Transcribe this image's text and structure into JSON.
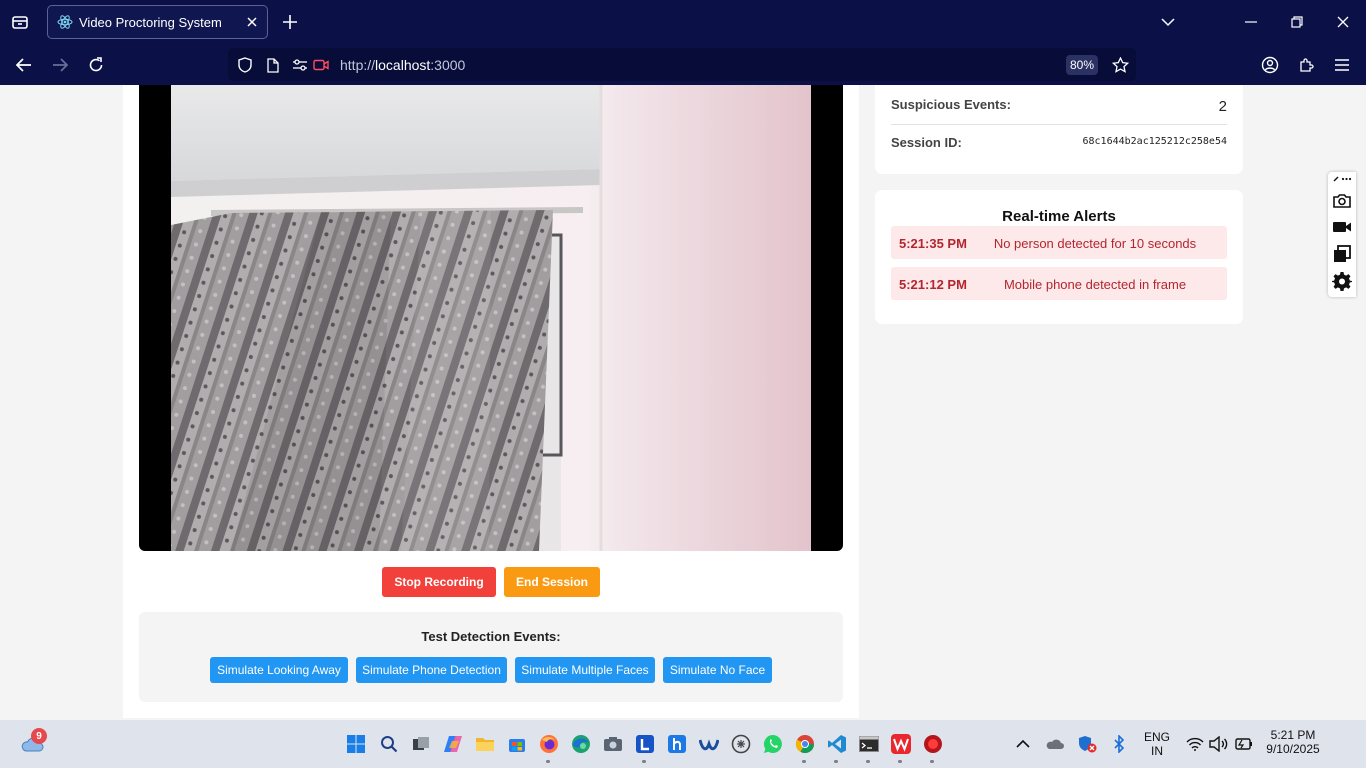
{
  "browser": {
    "tab_title": "Video Proctoring System",
    "url_scheme": "http://",
    "url_host": "localhost",
    "url_rest": ":3000",
    "zoom": "80%"
  },
  "session": {
    "suspicious_label": "Suspicious Events:",
    "suspicious_value": "2",
    "session_id_label": "Session ID:",
    "session_id_value": "68c1644b2ac125212c258e54"
  },
  "controls": {
    "stop_label": "Stop Recording",
    "end_label": "End Session"
  },
  "test_panel": {
    "title": "Test Detection Events:",
    "buttons": [
      "Simulate Looking Away",
      "Simulate Phone Detection",
      "Simulate Multiple Faces",
      "Simulate No Face"
    ]
  },
  "alerts": {
    "title": "Real-time Alerts",
    "items": [
      {
        "time": "5:21:35 PM",
        "message": "No person detected for 10 seconds"
      },
      {
        "time": "5:21:12 PM",
        "message": "Mobile phone detected in frame"
      }
    ]
  },
  "taskbar": {
    "weather_badge": "9",
    "language": "ENG",
    "region": "IN",
    "time": "5:21 PM",
    "date": "9/10/2025"
  },
  "colors": {
    "chrome": "#0b1146",
    "stop": "#f2403a",
    "end": "#fa9a12",
    "simulate": "#2196f3",
    "alert_bg": "#fde8ea",
    "alert_text": "#b3262e"
  }
}
